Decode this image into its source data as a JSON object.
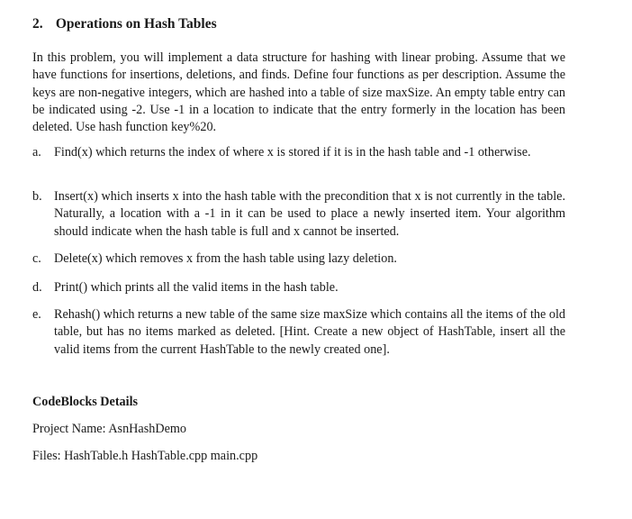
{
  "section": {
    "number": "2.",
    "title": "Operations on Hash Tables"
  },
  "intro": "In this problem, you will implement a data structure for hashing with linear probing. Assume that we have functions for insertions, deletions, and finds. Define four functions as per description. Assume the keys are non-negative integers, which are hashed into a table of size maxSize. An empty table entry can be indicated using -2. Use -1 in a location to indicate that the entry formerly in the location has been deleted. Use hash function key%20.",
  "items": [
    {
      "marker": "a.",
      "text": "Find(x) which returns the index of where x is stored if it is in the hash table and -1 otherwise."
    },
    {
      "marker": "b.",
      "text": "Insert(x) which inserts x into the hash table with the precondition that x is not currently in the table. Naturally, a location with a -1 in it can be used to place a newly inserted item. Your algorithm should indicate when the hash table is full and x cannot be inserted."
    },
    {
      "marker": "c.",
      "text": "Delete(x) which removes x from the hash table using lazy deletion."
    },
    {
      "marker": "d.",
      "text": "Print() which prints all the valid items in the hash table."
    },
    {
      "marker": "e.",
      "text": "Rehash() which returns a new table of the same size maxSize which contains all the items of the old table, but has no items marked as deleted. [Hint. Create a new object of HashTable, insert all the valid items from the current HashTable to the newly created one]."
    }
  ],
  "details": {
    "heading": "CodeBlocks Details",
    "project_name": "Project Name: AsnHashDemo",
    "files": "Files: HashTable.h HashTable.cpp main.cpp"
  }
}
